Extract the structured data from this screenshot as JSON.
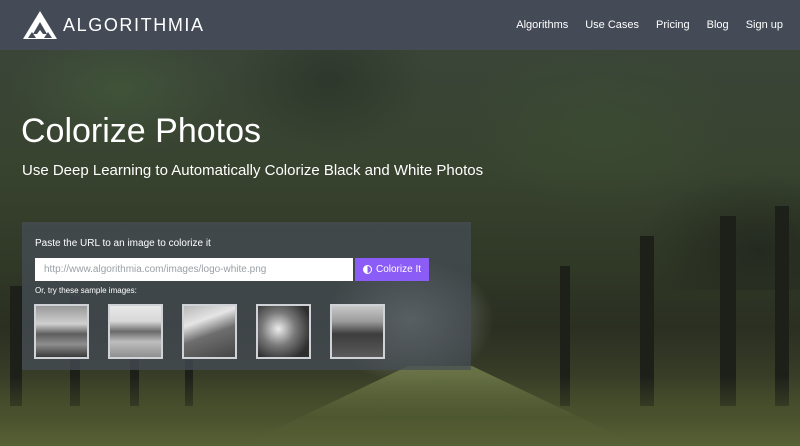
{
  "brand": {
    "name": "ALGORITHMIA",
    "logo_icon": "triangle-logo-icon",
    "nav_bg": "#444b57"
  },
  "nav": {
    "items": [
      {
        "label": "Algorithms"
      },
      {
        "label": "Use Cases"
      },
      {
        "label": "Pricing"
      },
      {
        "label": "Blog"
      },
      {
        "label": "Sign up"
      }
    ]
  },
  "hero": {
    "title": "Colorize Photos",
    "subtitle": "Use Deep Learning to Automatically Colorize Black and White Photos"
  },
  "form": {
    "url_label": "Paste the URL to an image to colorize it",
    "url_placeholder": "http://www.algorithmia.com/images/logo-white.png",
    "url_value": "",
    "submit_label": "Colorize It",
    "submit_icon": "half-circle-contrast-icon",
    "submit_color": "#8b5cf6",
    "samples_label": "Or, try these sample images:",
    "samples": [
      {
        "name": "sample-image-beach"
      },
      {
        "name": "sample-image-race-car"
      },
      {
        "name": "sample-image-mountain"
      },
      {
        "name": "sample-image-people"
      },
      {
        "name": "sample-image-cattle"
      }
    ]
  }
}
